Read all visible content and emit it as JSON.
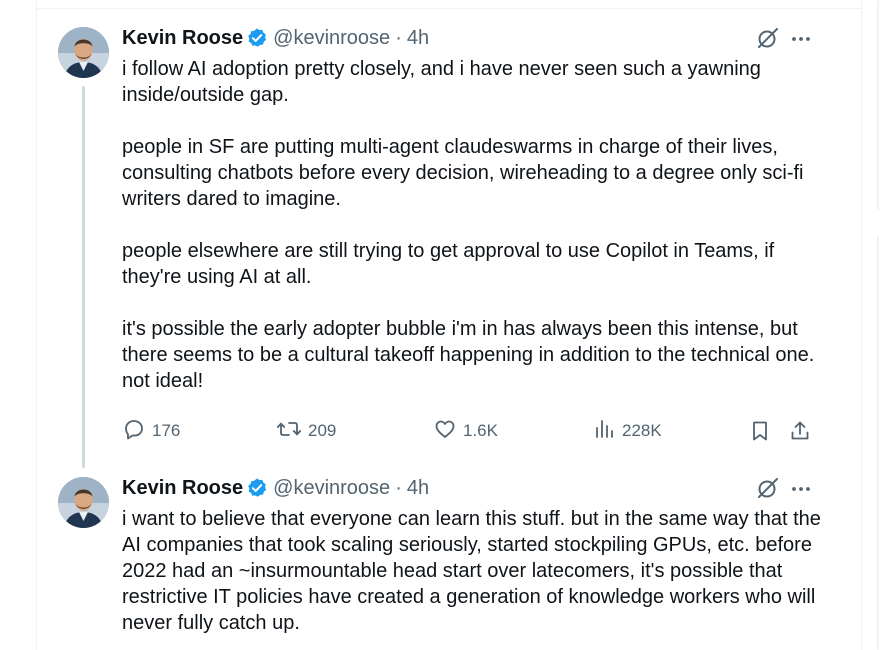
{
  "tweets": [
    {
      "author": {
        "name": "Kevin Roose",
        "handle": "@kevinroose",
        "time": "4h"
      },
      "dot": "·",
      "paragraphs": [
        "i follow AI adoption pretty closely, and i have never seen such a yawning inside/outside gap.",
        "people in SF are putting multi-agent claudeswarms in charge of their lives, consulting chatbots before every decision, wireheading to a degree only sci-fi writers dared to imagine.",
        "people elsewhere are still trying to get approval to use Copilot in Teams, if they're using AI at all.",
        "it's possible the early adopter bubble i'm in has always been this intense, but there seems to be a cultural takeoff happening in addition to the technical one. not ideal!"
      ],
      "stats": {
        "replies": "176",
        "reposts": "209",
        "likes": "1.6K",
        "views": "228K"
      }
    },
    {
      "author": {
        "name": "Kevin Roose",
        "handle": "@kevinroose",
        "time": "4h"
      },
      "dot": "·",
      "paragraphs": [
        "i want to believe that everyone can learn this stuff. but in the same way that the AI companies that took scaling seriously, started stockpiling GPUs, etc. before 2022 had an ~insurmountable head start over latecomers, it's possible that restrictive IT policies have created a generation of knowledge workers who will never fully catch up."
      ]
    }
  ],
  "icons": {
    "verified": "verified-badge-icon",
    "grok": "grok-icon",
    "more": "more-icon",
    "reply": "reply-icon",
    "repost": "repost-icon",
    "like": "like-icon",
    "views": "views-icon",
    "bookmark": "bookmark-icon",
    "share": "share-icon"
  },
  "colors": {
    "text": "#0f1419",
    "secondary": "#536471",
    "verified": "#1d9bf0",
    "thread_line": "#cfd9de",
    "divider": "#eff3f4"
  }
}
